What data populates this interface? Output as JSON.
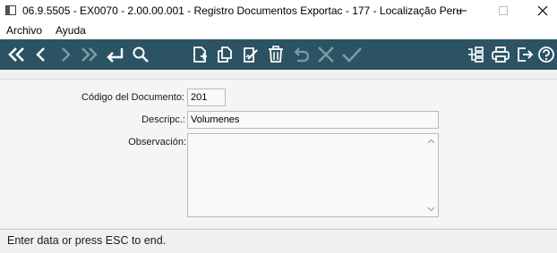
{
  "window": {
    "title": "06.9.5505 - EX0070 - 2.00.00.001 - Registro Documentos Exportac - 177 - Localização Peru"
  },
  "menu": {
    "items": [
      {
        "label": "Archivo"
      },
      {
        "label": "Ayuda"
      }
    ]
  },
  "toolbar": {
    "icons": [
      "first-record-icon",
      "previous-record-icon",
      "next-record-icon",
      "last-record-icon",
      "goto-icon",
      "search-icon",
      "new-document-icon",
      "copy-icon",
      "edit-icon",
      "delete-icon",
      "undo-icon",
      "cancel-icon",
      "confirm-icon",
      "structure-icon",
      "print-icon",
      "exit-icon",
      "help-icon"
    ],
    "bg_color": "#2c5364"
  },
  "form": {
    "codigo_label": "Código del Documento:",
    "codigo_value": "201",
    "descripc_label": "Descripc.:",
    "descripc_value": "Volumenes",
    "observacion_label": "Observación:",
    "observacion_value": ""
  },
  "status": {
    "text": "Enter data or press ESC to end."
  }
}
